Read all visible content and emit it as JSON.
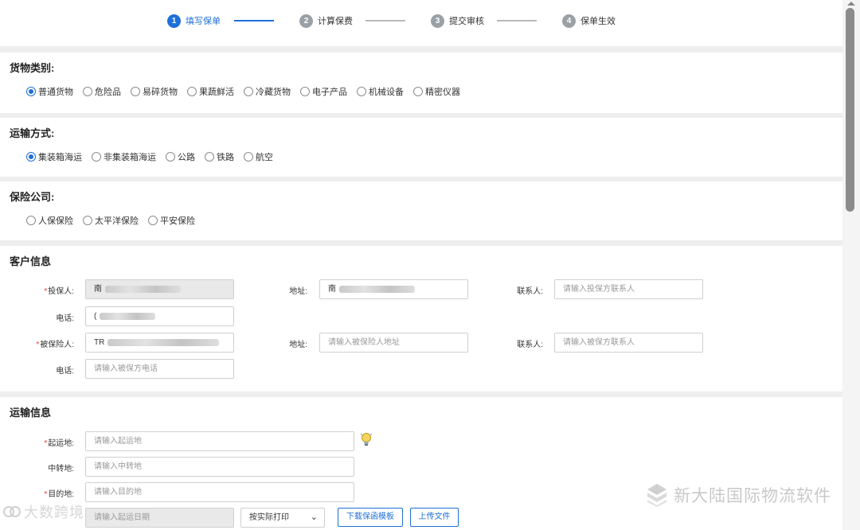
{
  "steps": [
    {
      "num": "1",
      "label": "填写保单"
    },
    {
      "num": "2",
      "label": "计算保费"
    },
    {
      "num": "3",
      "label": "提交审核"
    },
    {
      "num": "4",
      "label": "保单生效"
    }
  ],
  "cargo": {
    "title": "货物类别:",
    "options": [
      "普通货物",
      "危险品",
      "易碎货物",
      "果蔬鲜活",
      "冷藏货物",
      "电子产品",
      "机械设备",
      "精密仪器"
    ]
  },
  "transport": {
    "title": "运输方式:",
    "options": [
      "集装箱海运",
      "非集装箱海运",
      "公路",
      "铁路",
      "航空"
    ]
  },
  "insurer": {
    "title": "保险公司:",
    "options": [
      "人保保险",
      "太平洋保险",
      "平安保险"
    ]
  },
  "customer": {
    "title": "客户信息",
    "policyholder_label": "投保人:",
    "policyholder_value": "南",
    "address_label": "地址:",
    "policyholder_address": "南",
    "contact_label": "联系人:",
    "policyholder_contact_ph": "请输入投保方联系人",
    "phone_label": "电话:",
    "policyholder_phone": "(",
    "insured_label": "被保险人:",
    "insured_value": "TR",
    "insured_address_ph": "请输入被保险人地址",
    "insured_contact_ph": "请输入被保方联系人",
    "insured_phone_ph": "请输入被保方电话"
  },
  "shipping": {
    "title": "运输信息",
    "origin_label": "起运地:",
    "origin_ph": "请输入起运地",
    "transit_label": "中转地:",
    "transit_ph": "请输入中转地",
    "dest_label": "目的地:",
    "dest_ph": "请输入目的地",
    "date_ph": "请输入起运日期",
    "print_select": "按实际打印",
    "download_btn": "下载保函模板",
    "upload_btn": "上传文件"
  },
  "watermark": {
    "right": "新大陆国际物流软件",
    "left": "大数跨境"
  },
  "colors": {
    "accent": "#1e6fd9",
    "required": "#e33333"
  }
}
